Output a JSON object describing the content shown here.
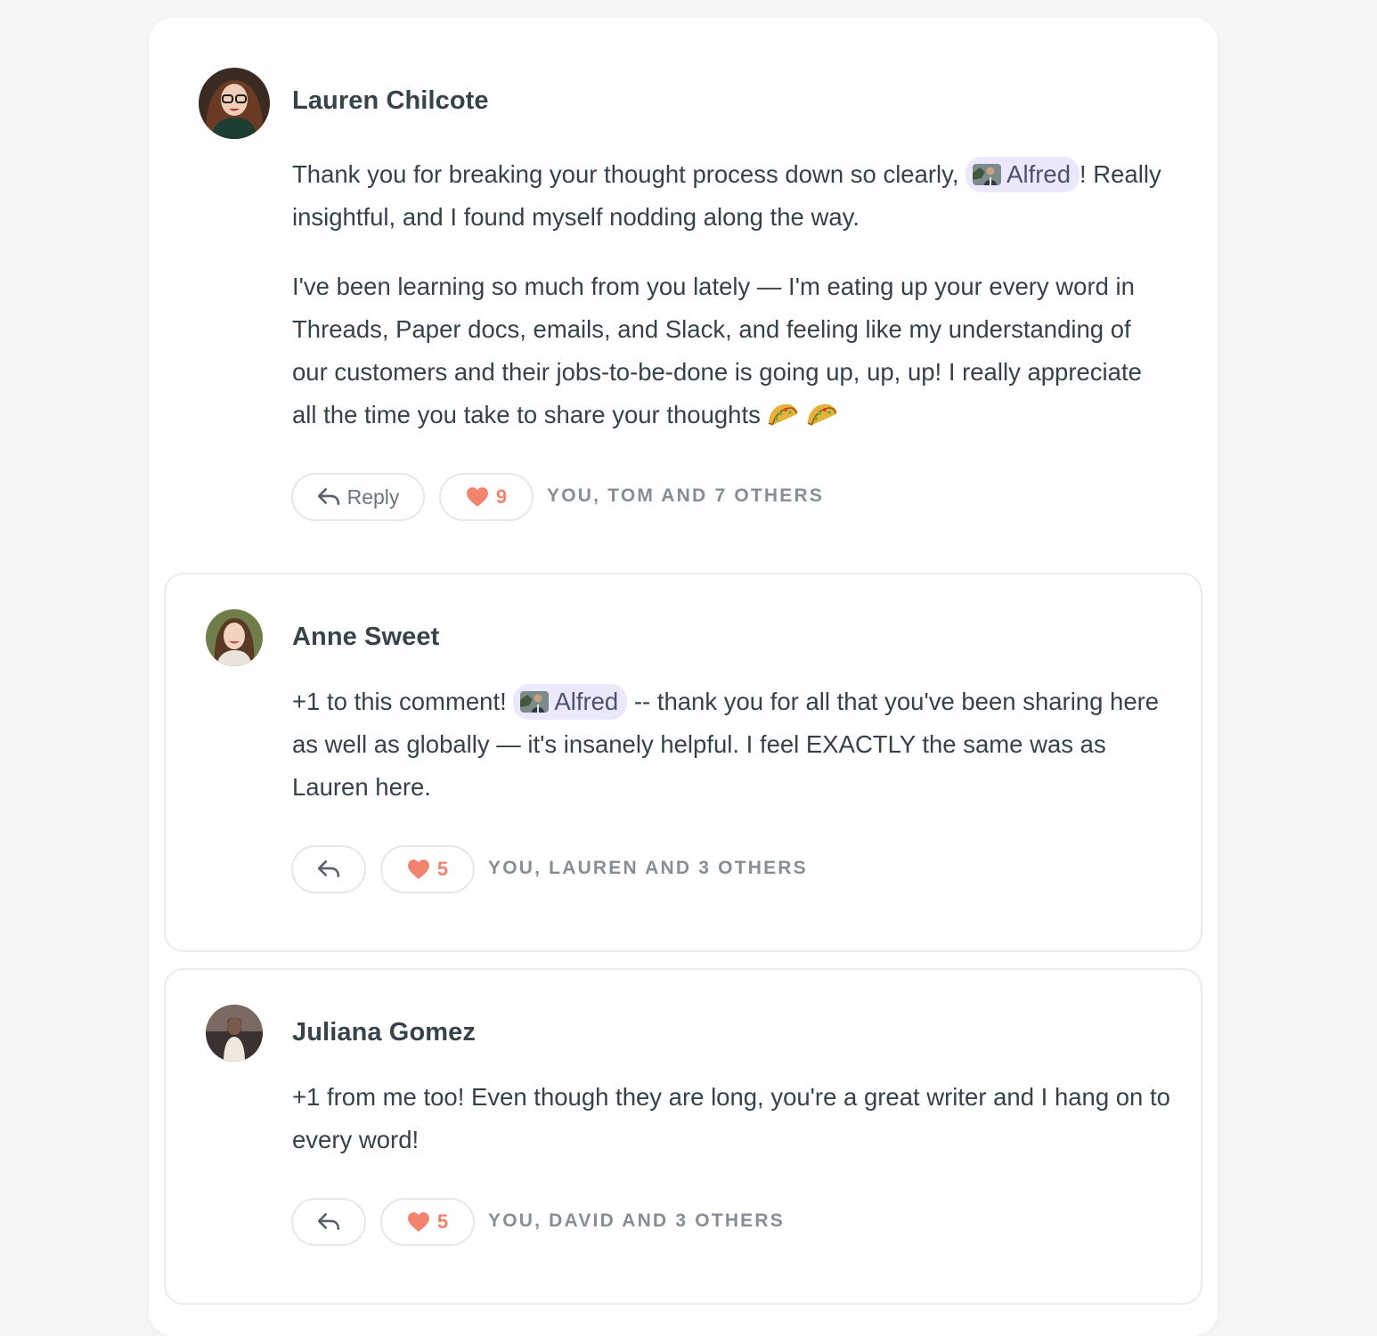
{
  "comments": [
    {
      "author": "Lauren Chilcote",
      "text_pre": "Thank you for breaking your thought process down so clearly,",
      "mention": "Alfred",
      "text_post": "! Really insightful, and I found myself nodding along the way.",
      "paragraph2": "I've been learning so much from you lately — I'm eating up your every word in Threads, Paper docs, emails, and Slack, and feeling like my understanding of our customers and their jobs-to-be-done is going up, up, up! I really appreciate all the time you take to share your thoughts",
      "reply_label": "Reply",
      "like_count": "9",
      "likers": "YOU, TOM AND 7 OTHERS"
    }
  ],
  "replies": [
    {
      "author": "Anne Sweet",
      "text_pre": "+1 to this comment!",
      "mention": "Alfred",
      "text_post": "-- thank you for all that you've been sharing here as well as globally — it's insanely helpful.  I feel EXACTLY the same was as Lauren here.",
      "like_count": "5",
      "likers": "YOU, LAUREN AND 3 OTHERS"
    },
    {
      "author": "Juliana Gomez",
      "text": "+1 from me too! Even though they are long, you're a great writer and I hang on to every word!",
      "like_count": "5",
      "likers": "YOU, DAVID AND 3 OTHERS"
    }
  ],
  "icons": {
    "reply": "reply-arrow-icon",
    "like": "heart-icon",
    "emoji": "taco-emoji-icon"
  },
  "colors": {
    "like_accent": "#f1836f",
    "mention_bg": "#ebe8fb",
    "text": "#36424a"
  }
}
